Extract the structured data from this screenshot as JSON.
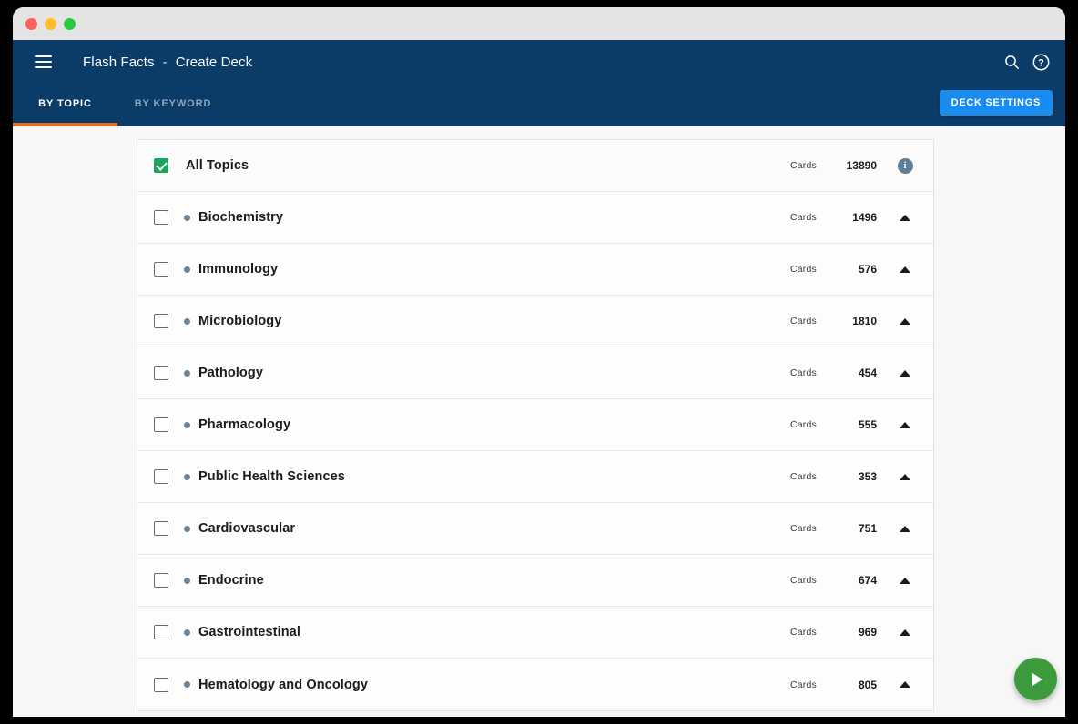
{
  "window": {
    "traffic_lights": [
      "close",
      "minimize",
      "maximize"
    ]
  },
  "header": {
    "menu_icon": "hamburger-menu-icon",
    "app_name": "Flash Facts",
    "separator": "-",
    "page_title": "Create Deck",
    "search_icon": "search-icon",
    "help_icon": "help-icon",
    "deck_settings_label": "DECK SETTINGS",
    "bg_color": "#0b3c68",
    "accent_color": "#ea6a1e",
    "button_color": "#1a8cf0"
  },
  "tabs": [
    {
      "label": "BY TOPIC",
      "active": true
    },
    {
      "label": "BY KEYWORD",
      "active": false
    }
  ],
  "list": {
    "cards_label": "Cards",
    "all_row": {
      "label": "All Topics",
      "cards_label": "Cards",
      "count": "13890",
      "checked": true,
      "action_icon": "info-icon"
    },
    "rows": [
      {
        "label": "Biochemistry",
        "cards_label": "Cards",
        "count": "1496",
        "checked": false,
        "action_icon": "caret-up-icon"
      },
      {
        "label": "Immunology",
        "cards_label": "Cards",
        "count": "576",
        "checked": false,
        "action_icon": "caret-up-icon"
      },
      {
        "label": "Microbiology",
        "cards_label": "Cards",
        "count": "1810",
        "checked": false,
        "action_icon": "caret-up-icon"
      },
      {
        "label": "Pathology",
        "cards_label": "Cards",
        "count": "454",
        "checked": false,
        "action_icon": "caret-up-icon"
      },
      {
        "label": "Pharmacology",
        "cards_label": "Cards",
        "count": "555",
        "checked": false,
        "action_icon": "caret-up-icon"
      },
      {
        "label": "Public Health Sciences",
        "cards_label": "Cards",
        "count": "353",
        "checked": false,
        "action_icon": "caret-up-icon"
      },
      {
        "label": "Cardiovascular",
        "cards_label": "Cards",
        "count": "751",
        "checked": false,
        "action_icon": "caret-up-icon"
      },
      {
        "label": "Endocrine",
        "cards_label": "Cards",
        "count": "674",
        "checked": false,
        "action_icon": "caret-up-icon"
      },
      {
        "label": "Gastrointestinal",
        "cards_label": "Cards",
        "count": "969",
        "checked": false,
        "action_icon": "caret-up-icon"
      },
      {
        "label": "Hematology and Oncology",
        "cards_label": "Cards",
        "count": "805",
        "checked": false,
        "action_icon": "caret-up-icon"
      }
    ]
  },
  "fab": {
    "icon": "play-icon",
    "color": "#3d9b3d"
  }
}
